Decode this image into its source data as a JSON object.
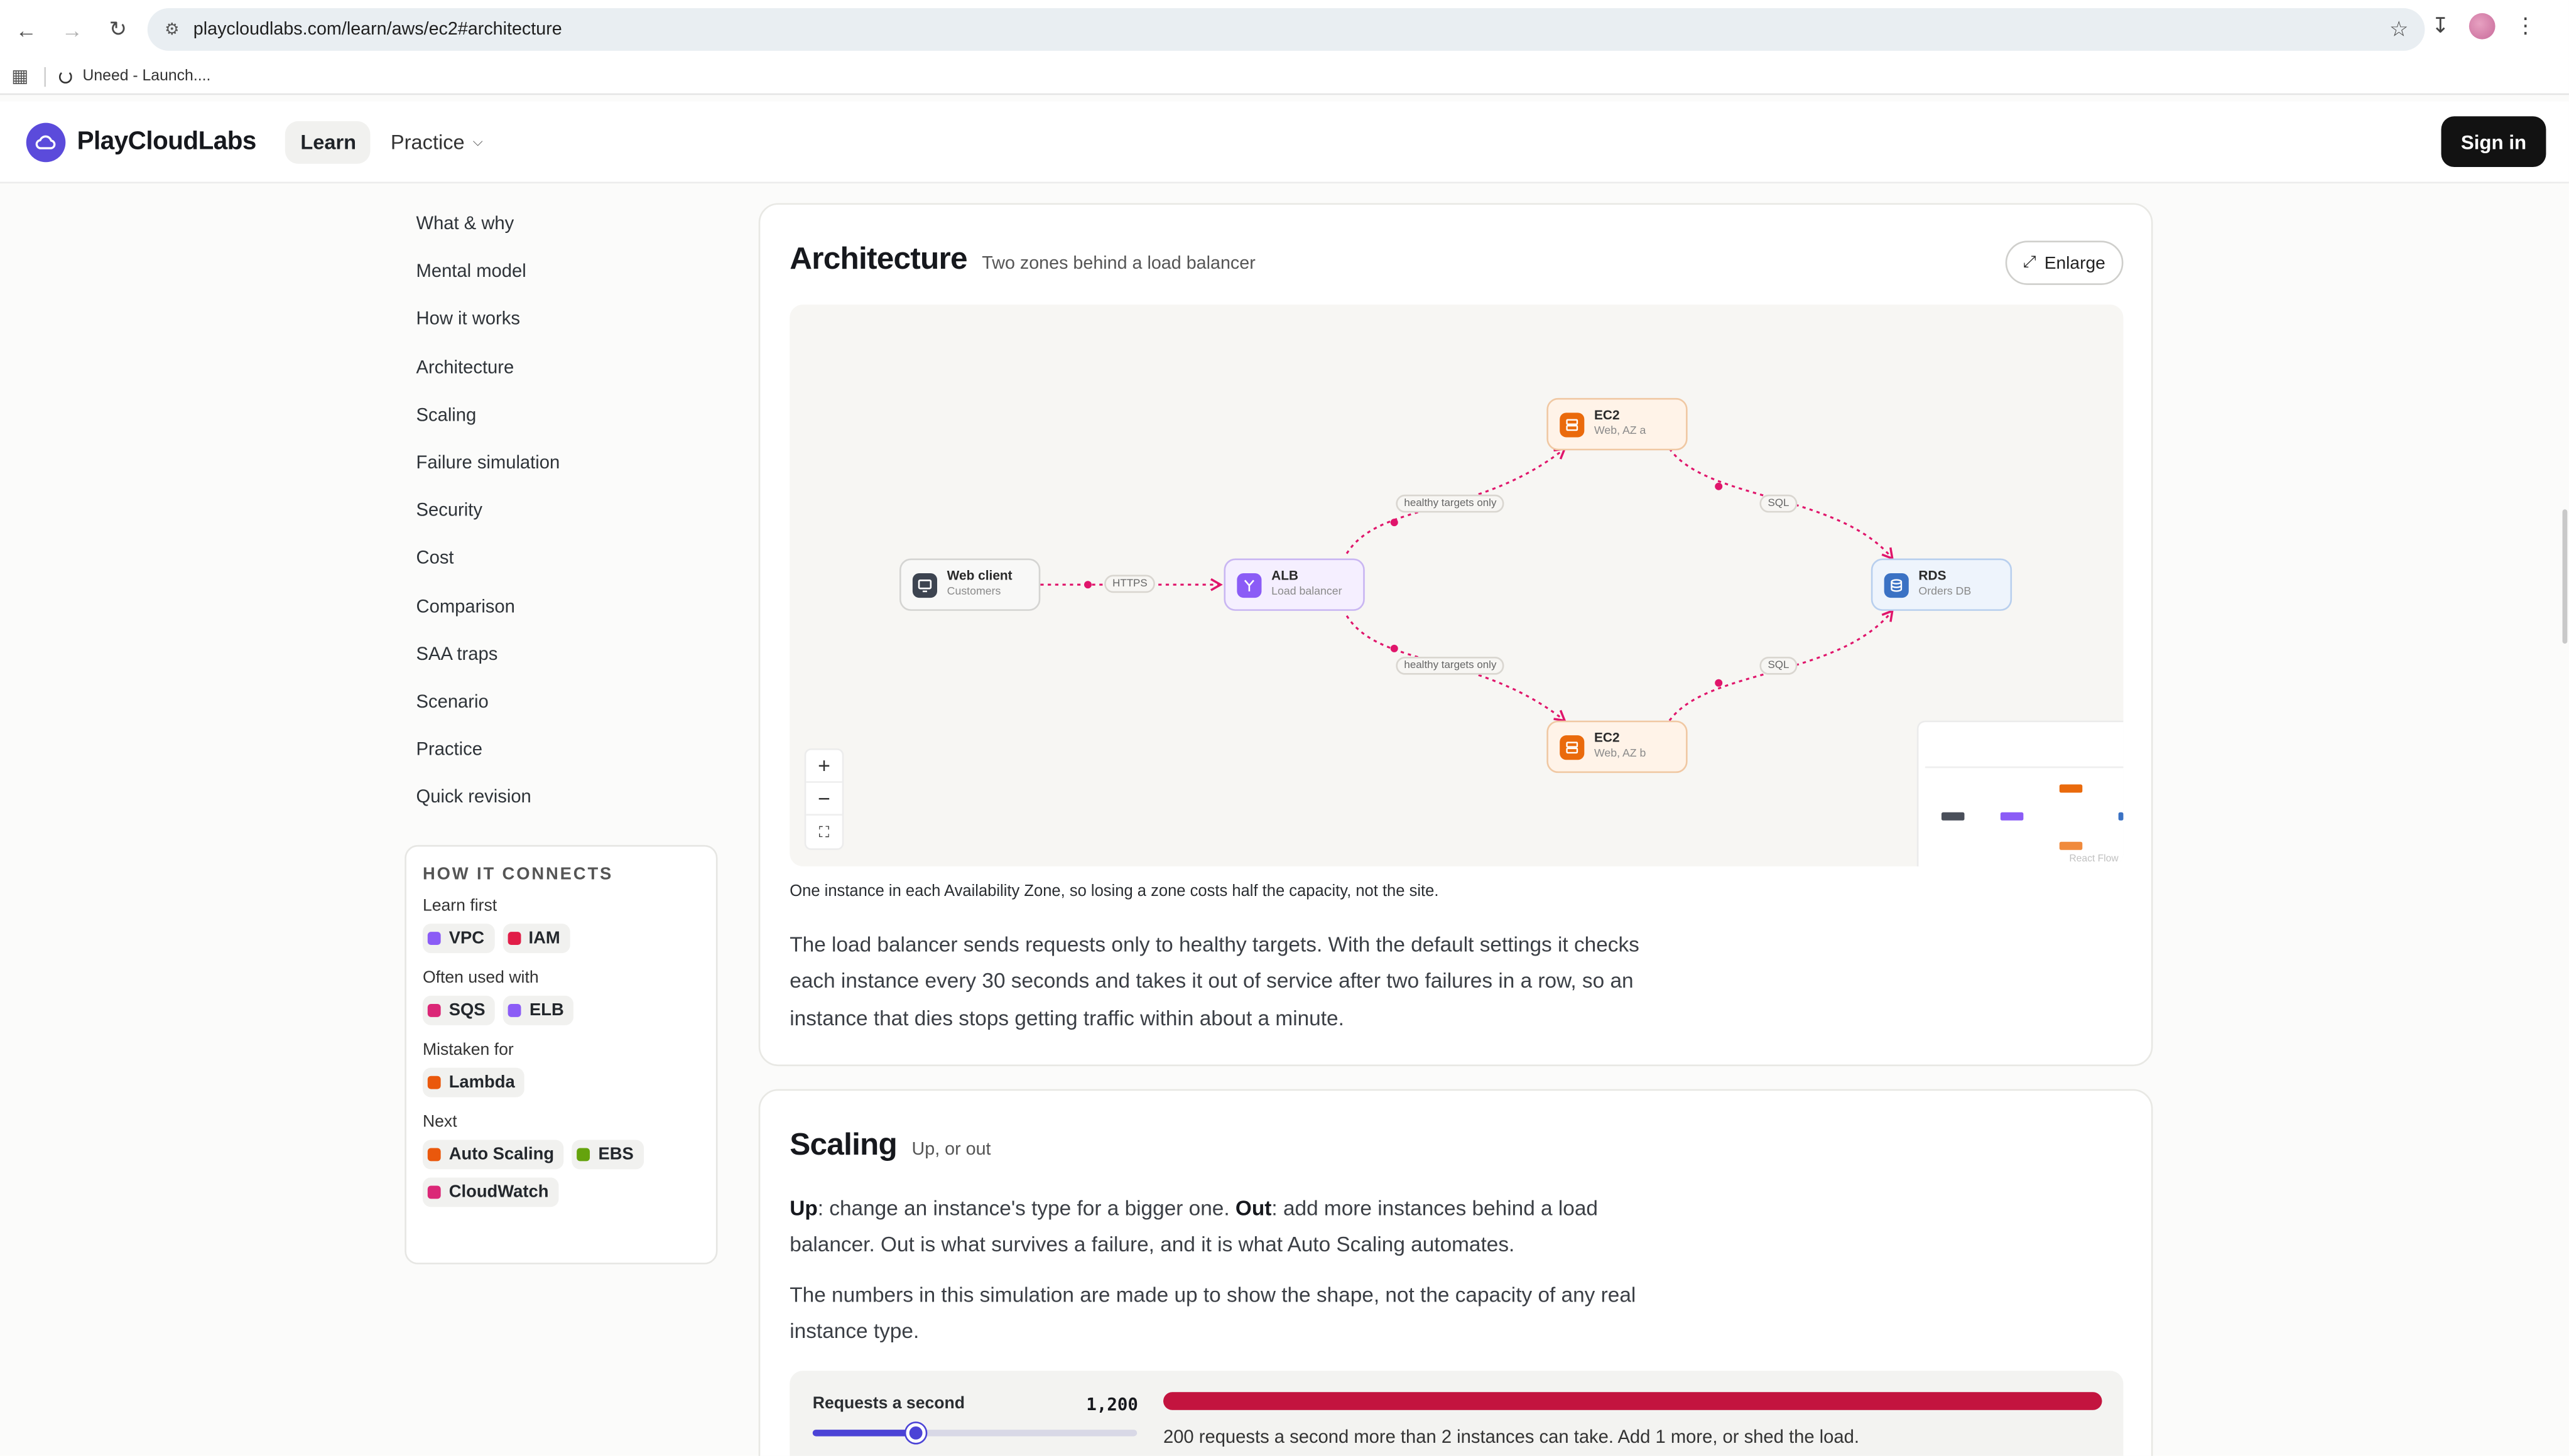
{
  "browser": {
    "url_host": "playcloudlabs.com",
    "url_path": "/learn/aws/ec2#architecture",
    "bookmark": "Uneed - Launch...."
  },
  "header": {
    "brand": "PlayCloudLabs",
    "nav_learn": "Learn",
    "nav_practice": "Practice",
    "sign_in": "Sign in"
  },
  "toc": {
    "items": [
      "What & why",
      "Mental model",
      "How it works",
      "Architecture",
      "Scaling",
      "Failure simulation",
      "Security",
      "Cost",
      "Comparison",
      "SAA traps",
      "Scenario",
      "Practice",
      "Quick revision"
    ]
  },
  "connects": {
    "heading": "HOW IT CONNECTS",
    "learn_first_label": "Learn first",
    "learn_first": [
      {
        "label": "VPC",
        "color": "#8b5cf6"
      },
      {
        "label": "IAM",
        "color": "#e11d48"
      }
    ],
    "often_label": "Often used with",
    "often": [
      {
        "label": "SQS",
        "color": "#db2777"
      },
      {
        "label": "ELB",
        "color": "#8b5cf6"
      }
    ],
    "mistaken_label": "Mistaken for",
    "mistaken": [
      {
        "label": "Lambda",
        "color": "#ea580c"
      }
    ],
    "next_label": "Next",
    "next": [
      {
        "label": "Auto Scaling",
        "color": "#ea580c"
      },
      {
        "label": "EBS",
        "color": "#65a30d"
      },
      {
        "label": "CloudWatch",
        "color": "#db2777"
      }
    ]
  },
  "architecture": {
    "title": "Architecture",
    "subtitle": "Two zones behind a load balancer",
    "enlarge": "Enlarge",
    "caption": "One instance in each Availability Zone, so losing a zone costs half the capacity, not the site.",
    "paragraph": "The load balancer sends requests only to healthy targets. With the default settings it checks each instance every 30 seconds and takes it out of service after two failures in a row, so an instance that dies stops getting traffic within about a minute.",
    "nodes": {
      "client": {
        "title": "Web client",
        "sub": "Customers"
      },
      "alb": {
        "title": "ALB",
        "sub": "Load balancer"
      },
      "ec2a": {
        "title": "EC2",
        "sub": "Web, AZ a"
      },
      "ec2b": {
        "title": "EC2",
        "sub": "Web, AZ b"
      },
      "rds": {
        "title": "RDS",
        "sub": "Orders DB"
      }
    },
    "edges": {
      "https": "HTTPS",
      "healthy_a": "healthy targets only",
      "healthy_b": "healthy targets only",
      "sql_a": "SQL",
      "sql_b": "SQL"
    },
    "attribution": "React Flow"
  },
  "scaling": {
    "title": "Scaling",
    "subtitle": "Up, or out",
    "p1_up": "Up",
    "p1_up_text": ": change an instance's type for a bigger one. ",
    "p1_out": "Out",
    "p1_out_text": ": add more instances behind a load balancer. Out is what survives a failure, and it is what Auto Scaling automates.",
    "p2": "The numbers in this simulation are made up to show the shape, not the capacity of any real instance type.",
    "sim_label": "Requests a second",
    "sim_value": "1,200",
    "slider_fraction": 0.32,
    "load_fraction": 1.0,
    "sim_message": "200 requests a second more than 2 instances can take. Add 1 more, or shed the load."
  }
}
